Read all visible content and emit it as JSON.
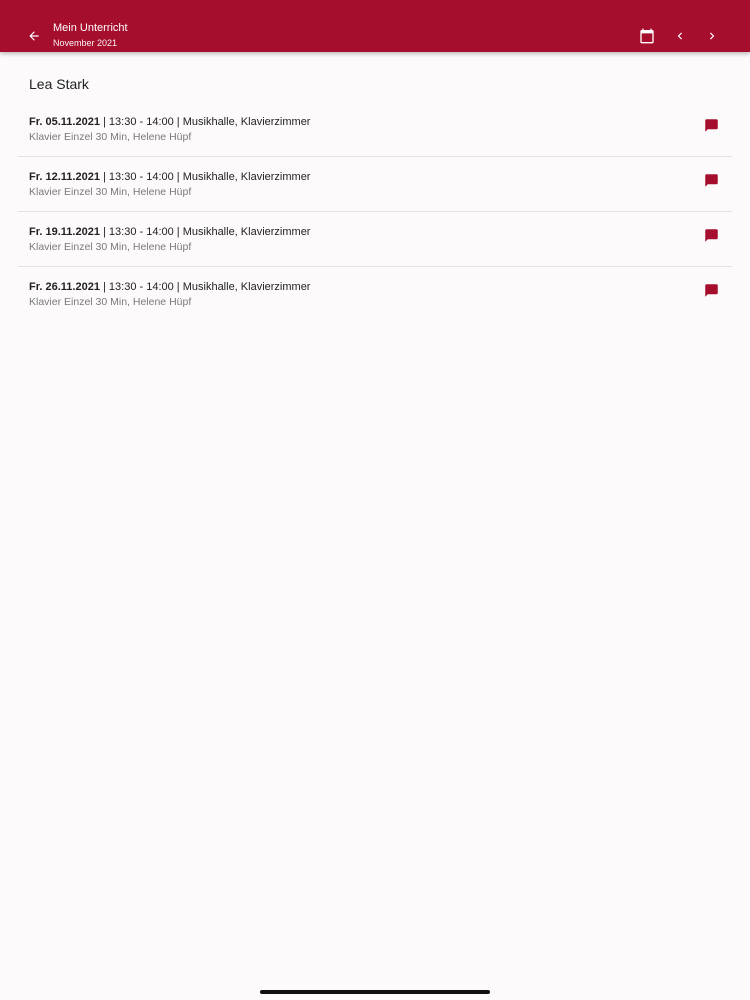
{
  "app": {
    "title": "Mein Unterricht",
    "subtitle": "November 2021",
    "accent_color": "#a50e2d"
  },
  "toolbar": {
    "back_icon": "arrow-back-icon",
    "calendar_icon": "calendar-icon",
    "prev_icon": "chevron-left-icon",
    "next_icon": "chevron-right-icon"
  },
  "student": {
    "name": "Lea Stark"
  },
  "lessons": [
    {
      "date": "Fr. 05.11.2021",
      "details": " | 13:30 - 14:00 | Musikhalle, Klavierzimmer",
      "course": "Klavier Einzel 30 Min, Helene Hüpf",
      "icon": "message-icon"
    },
    {
      "date": "Fr. 12.11.2021",
      "details": " | 13:30 - 14:00 | Musikhalle, Klavierzimmer",
      "course": "Klavier Einzel 30 Min, Helene Hüpf",
      "icon": "message-icon"
    },
    {
      "date": "Fr. 19.11.2021",
      "details": " | 13:30 - 14:00 | Musikhalle, Klavierzimmer",
      "course": "Klavier Einzel 30 Min, Helene Hüpf",
      "icon": "message-icon"
    },
    {
      "date": "Fr. 26.11.2021",
      "details": " | 13:30 - 14:00 | Musikhalle, Klavierzimmer",
      "course": "Klavier Einzel 30 Min, Helene Hüpf",
      "icon": "message-icon"
    }
  ]
}
